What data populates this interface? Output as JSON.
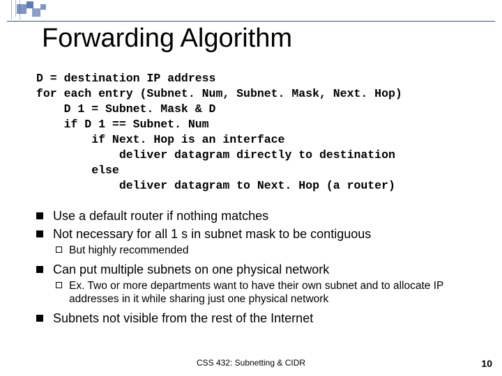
{
  "title": "Forwarding Algorithm",
  "code_lines": [
    "D = destination IP address",
    "for each entry (Subnet. Num, Subnet. Mask, Next. Hop)",
    "    D 1 = Subnet. Mask & D",
    "    if D 1 == Subnet. Num",
    "        if Next. Hop is an interface",
    "            deliver datagram directly to destination",
    "        else",
    "            deliver datagram to Next. Hop (a router)"
  ],
  "bullets": {
    "b1": "Use a default router if nothing matches",
    "b2": "Not necessary for all 1 s in subnet mask to be contiguous",
    "b2_sub": "But highly recommended",
    "b3": "Can put multiple subnets on one physical network",
    "b3_sub": "Ex. Two or more departments want to have their own subnet and to allocate IP addresses in it while sharing just one physical network",
    "b4": "Subnets not visible from the rest of the Internet"
  },
  "footer": "CSS 432: Subnetting & CIDR",
  "pagenum": "10"
}
